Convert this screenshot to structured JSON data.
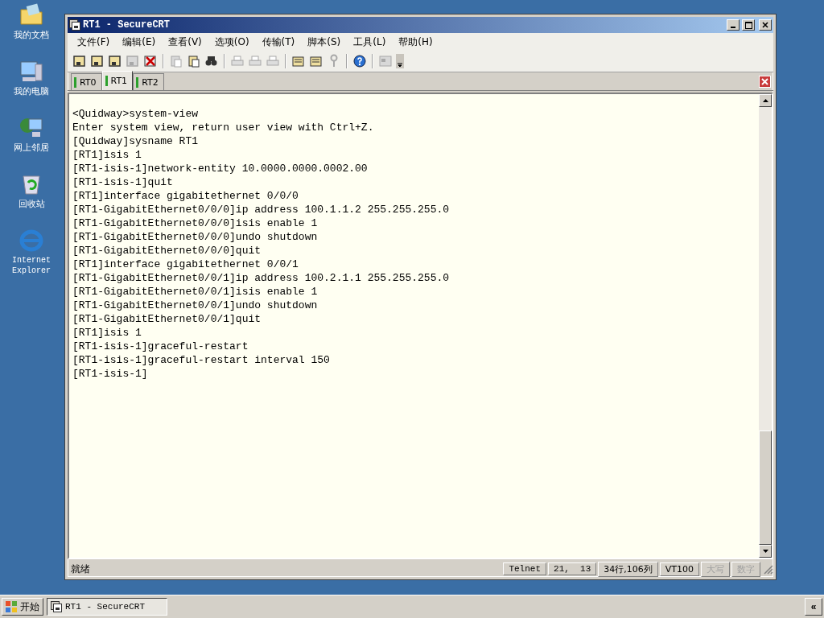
{
  "desktop_icons": [
    {
      "label": "我的文档"
    },
    {
      "label": "我的电脑"
    },
    {
      "label": "网上邻居"
    },
    {
      "label": "回收站"
    },
    {
      "label": "Internet Explorer"
    }
  ],
  "window": {
    "title": "RT1 - SecureCRT"
  },
  "menu": [
    "文件(F)",
    "编辑(E)",
    "查看(V)",
    "选项(O)",
    "传输(T)",
    "脚本(S)",
    "工具(L)",
    "帮助(H)"
  ],
  "toolbar_groups": [
    [
      {
        "disabled": false
      },
      {
        "disabled": false
      },
      {
        "disabled": false
      },
      {
        "disabled": true
      },
      {
        "disabled": false
      }
    ],
    [
      {
        "disabled": true
      },
      {
        "disabled": false
      },
      {
        "disabled": false
      }
    ],
    [
      {
        "disabled": true
      },
      {
        "disabled": true
      },
      {
        "disabled": true
      }
    ],
    [
      {
        "disabled": false
      },
      {
        "disabled": false
      },
      {
        "disabled": true
      }
    ],
    [
      {
        "disabled": false
      }
    ],
    [
      {
        "disabled": true
      }
    ]
  ],
  "tabs": [
    {
      "label": "RT0",
      "selected": false,
      "connected": true
    },
    {
      "label": "RT1",
      "selected": true,
      "connected": true
    },
    {
      "label": "RT2",
      "selected": false,
      "connected": true
    }
  ],
  "terminal_lines": [
    "<Quidway>system-view",
    "Enter system view, return user view with Ctrl+Z.",
    "[Quidway]sysname RT1",
    "[RT1]isis 1",
    "[RT1-isis-1]network-entity 10.0000.0000.0002.00",
    "[RT1-isis-1]quit",
    "[RT1]interface gigabitethernet 0/0/0",
    "[RT1-GigabitEthernet0/0/0]ip address 100.1.1.2 255.255.255.0",
    "[RT1-GigabitEthernet0/0/0]isis enable 1",
    "[RT1-GigabitEthernet0/0/0]undo shutdown",
    "[RT1-GigabitEthernet0/0/0]quit",
    "[RT1]interface gigabitethernet 0/0/1",
    "[RT1-GigabitEthernet0/0/1]ip address 100.2.1.1 255.255.255.0",
    "[RT1-GigabitEthernet0/0/1]isis enable 1",
    "[RT1-GigabitEthernet0/0/1]undo shutdown",
    "[RT1-GigabitEthernet0/0/1]quit",
    "[RT1]isis 1",
    "[RT1-isis-1]graceful-restart",
    "[RT1-isis-1]graceful-restart interval 150",
    "[RT1-isis-1]"
  ],
  "status_bar": {
    "message": "就绪",
    "panes": [
      {
        "text": "Telnet",
        "active": true
      },
      {
        "text": "21,  13",
        "active": true
      },
      {
        "text": "34行,106列",
        "active": true
      },
      {
        "text": "VT100",
        "active": true
      },
      {
        "text": "大写",
        "active": false
      },
      {
        "text": "数字",
        "active": false
      }
    ]
  },
  "taskbar": {
    "start": "开始",
    "tasks": [
      {
        "label": "RT1 - SecureCRT",
        "selected": true
      }
    ],
    "tray_toggle": "«"
  }
}
